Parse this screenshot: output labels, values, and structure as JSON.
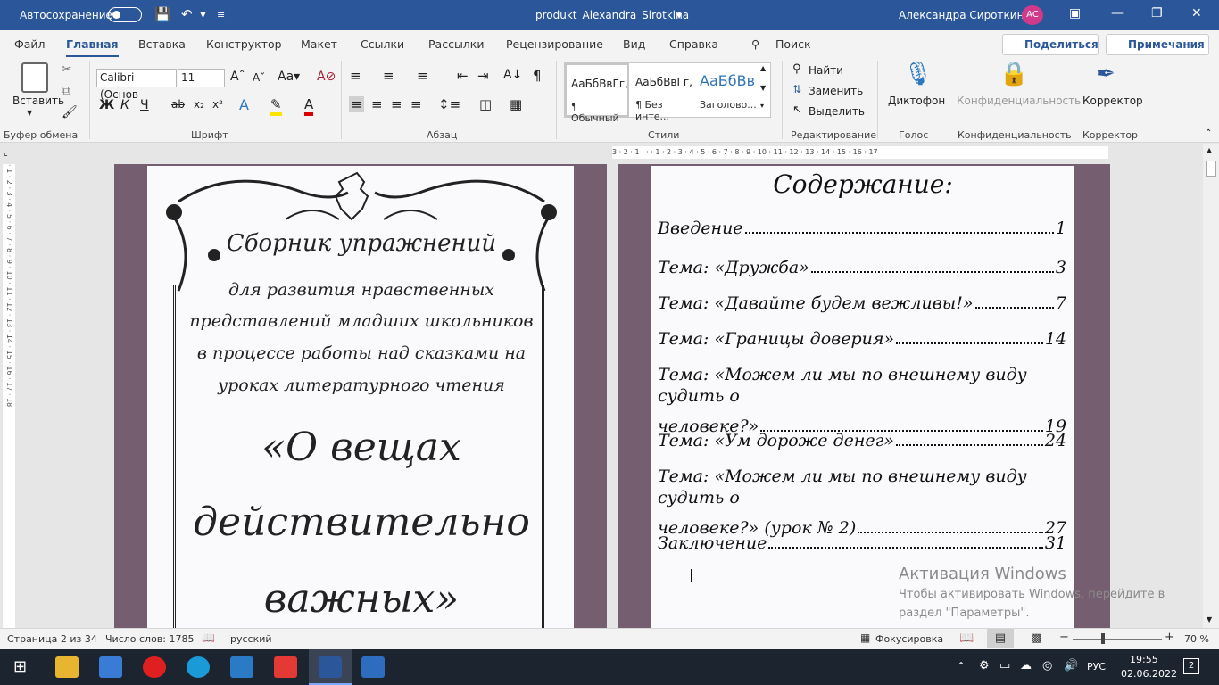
{
  "titlebar": {
    "autosave_label": "Автосохранение",
    "doc_title": "produkt_Alexandra_Sirotkina",
    "user_name": "Александра Сироткина",
    "user_initials": "АС"
  },
  "menu": {
    "items": [
      "Файл",
      "Главная",
      "Вставка",
      "Конструктор",
      "Макет",
      "Ссылки",
      "Рассылки",
      "Рецензирование",
      "Вид",
      "Справка"
    ],
    "search_label": "Поиск",
    "share_label": "Поделиться",
    "notes_label": "Примечания"
  },
  "ribbon": {
    "paste_label": "Вставить",
    "font_name": "Calibri (Основ",
    "font_size": "11",
    "groups": {
      "clipboard": "Буфер обмена",
      "font": "Шрифт",
      "paragraph": "Абзац",
      "styles": "Стили",
      "editing": "Редактирование",
      "voice": "Голос",
      "privacy": "Конфиденциальность",
      "corrector": "Корректор"
    },
    "styles": [
      {
        "sample": "АаБбВвГг,",
        "name": "¶ Обычный"
      },
      {
        "sample": "АаБбВвГг,",
        "name": "¶ Без инте..."
      },
      {
        "sample": "АаБбВв",
        "name": "Заголово..."
      }
    ],
    "find_label": "Найти",
    "replace_label": "Заменить",
    "select_label": "Выделить",
    "dictate_label": "Диктофон",
    "privacy_label": "Конфиденциальность",
    "corrector_label": "Корректор"
  },
  "ruler": {
    "h_ticks": "3 · 2 · 1 · · · 1 · 2 · 3 · 4 · 5 · 6 · 7 · 8 · 9 · 10 · 11 · 12 · 13 · 14 · 15 · 16 · 17",
    "v_ticks": "· 1 · 2 · 3 · 4 · 5 · 6 · 7 · 8 · 9 · 10 · 11 · 12 · 13 · 14 · 15 · 16 · 17 · 18"
  },
  "cover": {
    "heading": "Сборник упражнений",
    "subtitle": [
      "для развития нравственных",
      "представлений младших школьников",
      "в процессе работы над сказками на",
      "уроках литературного чтения"
    ],
    "big_title": [
      "«О вещах",
      "действительно",
      "важных»"
    ]
  },
  "toc": {
    "title": "Содержание:",
    "entries": [
      {
        "text": "Введение",
        "page": "1"
      },
      {
        "text": "Тема: «Дружба»",
        "page": "3"
      },
      {
        "text": "Тема: «Давайте будем вежливы!»",
        "page": "7"
      },
      {
        "text": "Тема: «Границы доверия»",
        "page": "14"
      },
      {
        "text_line1": "Тема: «Можем ли мы по внешнему виду судить о",
        "text_line2": "человеке?»",
        "page": "19"
      },
      {
        "text": "Тема: «Ум дороже денег»",
        "page": "24"
      },
      {
        "text_line1": "Тема: «Можем ли мы по внешнему виду судить о",
        "text_line2": "человеке?» (урок № 2)",
        "page": "27"
      },
      {
        "text": "Заключение",
        "page": "31"
      }
    ]
  },
  "watermark": {
    "title": "Активация Windows",
    "line1": "Чтобы активировать Windows, перейдите в",
    "line2": "раздел \"Параметры\"."
  },
  "status": {
    "page": "Страница 2 из 34",
    "words": "Число слов: 1785",
    "language": "русский",
    "focus": "Фокусировка",
    "zoom": "70 %"
  },
  "taskbar": {
    "lang": "РУС",
    "time": "19:55",
    "date": "02.06.2022",
    "notifications": "2"
  },
  "colors": {
    "word_blue": "#2b579a",
    "page_frame": "#745e70"
  }
}
